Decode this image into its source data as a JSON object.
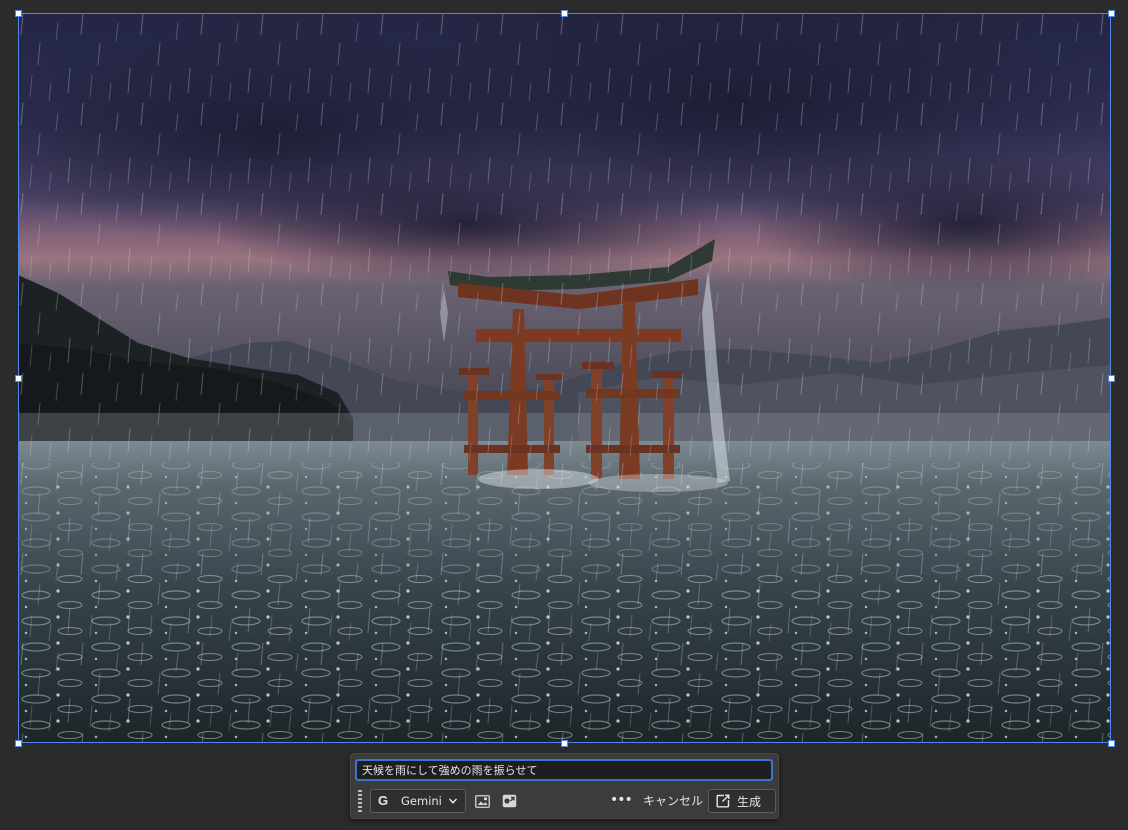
{
  "canvas": {
    "image_subject": "torii-gate-in-heavy-rain"
  },
  "prompt": {
    "value": "天候を雨にして強めの雨を振らせて",
    "placeholder": ""
  },
  "toolbar": {
    "model_icon": "google-g-icon",
    "model_label": "Gemini",
    "dropdown_icon": "chevron-down-icon",
    "reference_image_icon": "image-reference-icon",
    "style_reference_icon": "style-reference-icon",
    "more_icon": "more-options-icon",
    "more_label": "•••",
    "cancel_label": "キャンセル",
    "generate_icon": "generate-icon",
    "generate_label": "生成"
  },
  "colors": {
    "app_background": "#2b2b2b",
    "selection_accent": "#4f86e8",
    "input_focus": "#3b73d4",
    "panel_background": "#3c3c3c"
  }
}
